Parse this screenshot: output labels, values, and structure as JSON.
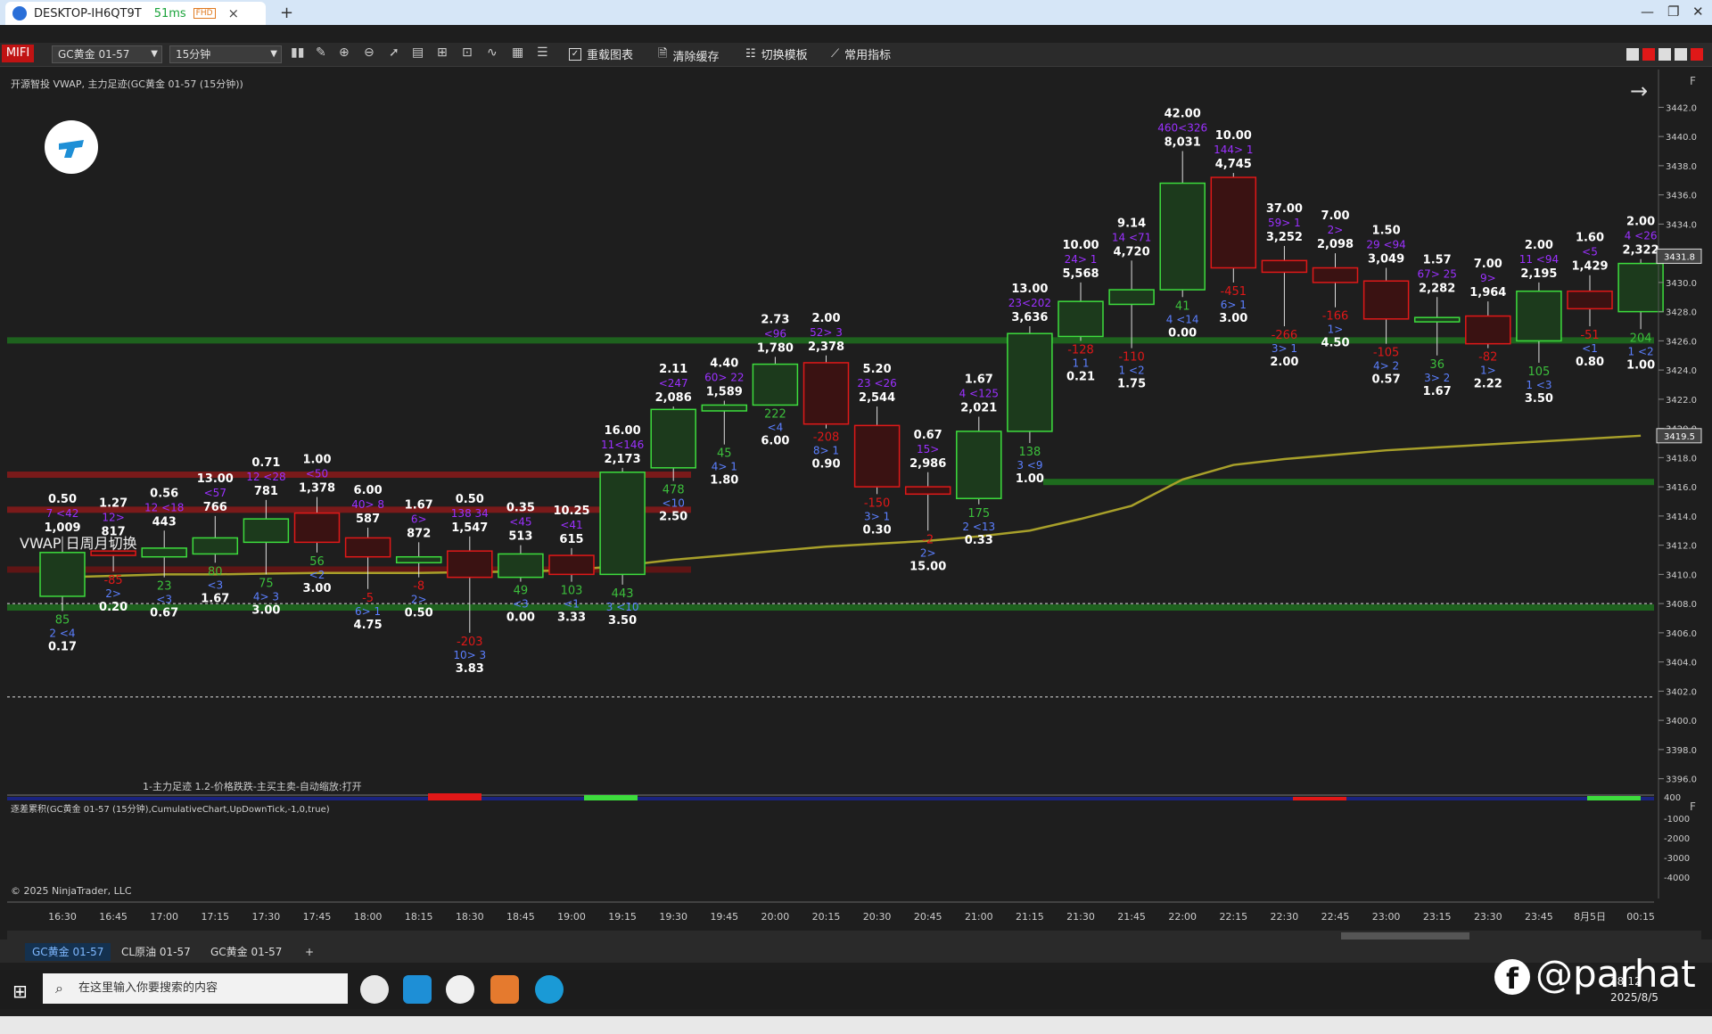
{
  "browser": {
    "tab_title": "DESKTOP-IH6QT9T",
    "latency": "51ms",
    "quality_badge": "FHD",
    "close_glyph": "×",
    "new_tab_glyph": "+",
    "win_min": "—",
    "win_max": "❐",
    "win_close": "✕"
  },
  "toolbar": {
    "logo_text": "MIFI",
    "instrument_select": "GC黄金 01-57",
    "interval_select": "15分钟",
    "reload_label": "重载图表",
    "clear_cache_label": "清除缓存",
    "switch_template_label": "切换模板",
    "common_indicators_label": "常用指标"
  },
  "chart_header": {
    "title": "开源智投 VWAP, 主力足迹(GC黄金 01-57 (15分钟))",
    "vwap_note": "VWAP 日周月切换",
    "indicator_note": "1-主力足迹 1.2-价格跌跌-主买主卖-自动缩放:打开",
    "sub_title": "逐差累积(GC黄金 01-57 (15分钟),CumulativeChart,UpDownTick,-1,0,true)",
    "copyright": "© 2025 NinjaTrader, LLC",
    "panel_flag": "F",
    "arrow_glyph": "→"
  },
  "chart_data": {
    "type": "candlestick",
    "y_axis_labels": [
      "3442.0",
      "3440.0",
      "3438.0",
      "3436.0",
      "3434.0",
      "3432.0",
      "3430.0",
      "3428.0",
      "3426.0",
      "3424.0",
      "3422.0",
      "3420.0",
      "3418.0",
      "3416.0",
      "3414.0",
      "3412.0",
      "3410.0",
      "3408.0",
      "3406.0",
      "3404.0",
      "3402.0",
      "3400.0",
      "3398.0",
      "3396.0"
    ],
    "ylim": [
      3395,
      3443
    ],
    "price_markers": [
      {
        "label": "3431.8",
        "value": 3431.8
      },
      {
        "label": "3419.5",
        "value": 3419.5
      }
    ],
    "sub_axis_labels": [
      "400",
      "-1000",
      "-2000",
      "-3000",
      "-4000"
    ],
    "x_labels": [
      "16:30",
      "16:45",
      "17:00",
      "17:15",
      "17:30",
      "17:45",
      "18:00",
      "18:15",
      "18:30",
      "18:45",
      "19:00",
      "19:15",
      "19:30",
      "19:45",
      "20:00",
      "20:15",
      "20:30",
      "20:45",
      "21:00",
      "21:15",
      "21:30",
      "21:45",
      "22:00",
      "22:15",
      "22:30",
      "22:45",
      "23:00",
      "23:15",
      "23:30",
      "23:45",
      "8月5日",
      "00:15"
    ],
    "candles": [
      {
        "o": 3408.5,
        "c": 3411.5,
        "h": 3412.6,
        "l": 3407.5,
        "up": true,
        "top": [
          "0.50",
          "7 <42",
          "1,009"
        ],
        "bot": [
          "85",
          "2 <4",
          "0.17"
        ]
      },
      {
        "o": 3411.6,
        "c": 3411.3,
        "h": 3412.3,
        "l": 3410.2,
        "up": false,
        "top": [
          "1.27",
          "12>",
          "817"
        ],
        "bot": [
          "-85",
          "2>",
          "0.20"
        ]
      },
      {
        "o": 3411.2,
        "c": 3411.8,
        "h": 3413.0,
        "l": 3409.8,
        "up": true,
        "top": [
          "0.56",
          "12 <18",
          "443"
        ],
        "bot": [
          "23",
          "<3",
          "0.67"
        ]
      },
      {
        "o": 3411.4,
        "c": 3412.5,
        "h": 3414.0,
        "l": 3410.8,
        "up": true,
        "top": [
          "13.00",
          "<57",
          "766"
        ],
        "bot": [
          "80",
          "<3",
          "1.67"
        ]
      },
      {
        "o": 3412.2,
        "c": 3413.8,
        "h": 3415.1,
        "l": 3410.0,
        "up": true,
        "top": [
          "0.71",
          "12 <28",
          "781"
        ],
        "bot": [
          "75",
          "4> 3",
          "3.00"
        ]
      },
      {
        "o": 3414.2,
        "c": 3412.2,
        "h": 3415.3,
        "l": 3411.5,
        "up": false,
        "top": [
          "1.00",
          "<50",
          "1,378"
        ],
        "bot": [
          "56",
          "<2",
          "3.00"
        ]
      },
      {
        "o": 3412.5,
        "c": 3411.2,
        "h": 3413.2,
        "l": 3409.0,
        "up": false,
        "top": [
          "6.00",
          "40> 8",
          "587"
        ],
        "bot": [
          "-5",
          "6> 1",
          "4.75"
        ]
      },
      {
        "o": 3410.8,
        "c": 3411.2,
        "h": 3412.2,
        "l": 3409.8,
        "up": true,
        "top": [
          "1.67",
          "6>",
          "872"
        ],
        "bot": [
          "-8",
          "2>",
          "0.50"
        ]
      },
      {
        "o": 3411.6,
        "c": 3409.8,
        "h": 3412.6,
        "l": 3406.0,
        "up": false,
        "top": [
          "0.50",
          "138 34",
          "1,547"
        ],
        "bot": [
          "-203",
          "10> 3",
          "3.83"
        ]
      },
      {
        "o": 3409.8,
        "c": 3411.4,
        "h": 3412.0,
        "l": 3409.5,
        "up": true,
        "top": [
          "0.35",
          "<45",
          "513"
        ],
        "bot": [
          "49",
          "<3",
          "0.00"
        ]
      },
      {
        "o": 3411.3,
        "c": 3410.0,
        "h": 3411.8,
        "l": 3409.5,
        "up": false,
        "top": [
          "10.25",
          "<41",
          "615"
        ],
        "bot": [
          "103",
          "<1",
          "3.33"
        ]
      },
      {
        "o": 3410.0,
        "c": 3417.0,
        "h": 3417.3,
        "l": 3409.3,
        "up": true,
        "top": [
          "16.00",
          "11<146",
          "2,173"
        ],
        "bot": [
          "443",
          "3 <10",
          "3.50"
        ]
      },
      {
        "o": 3417.3,
        "c": 3421.3,
        "h": 3421.5,
        "l": 3416.4,
        "up": true,
        "top": [
          "2.11",
          "<247",
          "2,086"
        ],
        "bot": [
          "478",
          "<10",
          "2.50"
        ]
      },
      {
        "o": 3421.2,
        "c": 3421.6,
        "h": 3421.9,
        "l": 3418.9,
        "up": true,
        "top": [
          "4.40",
          "60> 22",
          "1,589"
        ],
        "bot": [
          "45",
          "4> 1",
          "1.80"
        ]
      },
      {
        "o": 3421.6,
        "c": 3424.4,
        "h": 3424.9,
        "l": 3421.6,
        "up": true,
        "top": [
          "2.73",
          "<96",
          "1,780"
        ],
        "bot": [
          "222",
          "<4",
          "6.00"
        ]
      },
      {
        "o": 3424.5,
        "c": 3420.3,
        "h": 3425.0,
        "l": 3420.0,
        "up": false,
        "top": [
          "2.00",
          "52> 3",
          "2,378"
        ],
        "bot": [
          "-208",
          "8> 1",
          "0.90"
        ]
      },
      {
        "o": 3420.2,
        "c": 3416.0,
        "h": 3421.5,
        "l": 3415.5,
        "up": false,
        "top": [
          "5.20",
          "23 <26",
          "2,544"
        ],
        "bot": [
          "-150",
          "3> 1",
          "0.30"
        ]
      },
      {
        "o": 3416.0,
        "c": 3415.5,
        "h": 3417.0,
        "l": 3413.0,
        "up": false,
        "top": [
          "0.67",
          "15>",
          "2,986"
        ],
        "bot": [
          "-2",
          "2>",
          "15.00"
        ]
      },
      {
        "o": 3415.2,
        "c": 3419.8,
        "h": 3420.8,
        "l": 3414.8,
        "up": true,
        "top": [
          "1.67",
          "4 <125",
          "2,021"
        ],
        "bot": [
          "175",
          "2 <13",
          "0.33"
        ]
      },
      {
        "o": 3419.8,
        "c": 3426.5,
        "h": 3427.0,
        "l": 3419.0,
        "up": true,
        "top": [
          "13.00",
          "23<202",
          "3,636"
        ],
        "bot": [
          "138",
          "3 <9",
          "1.00"
        ]
      },
      {
        "o": 3426.3,
        "c": 3428.7,
        "h": 3430.0,
        "l": 3426.0,
        "up": true,
        "top": [
          "10.00",
          "24> 1",
          "5,568"
        ],
        "bot": [
          "-128",
          "1 1",
          "0.21"
        ]
      },
      {
        "o": 3428.5,
        "c": 3429.5,
        "h": 3431.5,
        "l": 3425.5,
        "up": true,
        "top": [
          "9.14",
          "14 <71",
          "4,720"
        ],
        "bot": [
          "-110",
          "1 <2",
          "1.75"
        ]
      },
      {
        "o": 3429.5,
        "c": 3436.8,
        "h": 3439.0,
        "l": 3429.0,
        "up": true,
        "top": [
          "42.00",
          "460<326",
          "8,031"
        ],
        "bot": [
          "41",
          "4 <14",
          "0.00"
        ]
      },
      {
        "o": 3437.2,
        "c": 3431.0,
        "h": 3437.5,
        "l": 3430.0,
        "up": false,
        "top": [
          "10.00",
          "144> 1",
          "4,745"
        ],
        "bot": [
          "-451",
          "6> 1",
          "3.00"
        ]
      },
      {
        "o": 3431.5,
        "c": 3430.7,
        "h": 3432.5,
        "l": 3427.0,
        "up": false,
        "top": [
          "37.00",
          "59> 1",
          "3,252"
        ],
        "bot": [
          "-266",
          "3> 1",
          "2.00"
        ]
      },
      {
        "o": 3431.0,
        "c": 3430.0,
        "h": 3432.0,
        "l": 3428.3,
        "up": false,
        "top": [
          "7.00",
          "2>",
          "2,098"
        ],
        "bot": [
          "-166",
          "1>",
          "4.50"
        ]
      },
      {
        "o": 3430.1,
        "c": 3427.5,
        "h": 3431.0,
        "l": 3425.8,
        "up": false,
        "top": [
          "1.50",
          "29 <94",
          "3,049"
        ],
        "bot": [
          "-105",
          "4> 2",
          "0.57"
        ]
      },
      {
        "o": 3427.3,
        "c": 3427.6,
        "h": 3429.0,
        "l": 3425.0,
        "up": true,
        "top": [
          "1.57",
          "67> 25",
          "2,282"
        ],
        "bot": [
          "36",
          "3> 2",
          "1.67"
        ]
      },
      {
        "o": 3427.7,
        "c": 3425.8,
        "h": 3428.7,
        "l": 3425.5,
        "up": false,
        "top": [
          "7.00",
          "9>",
          "1,964"
        ],
        "bot": [
          "-82",
          "1>",
          "2.22"
        ]
      },
      {
        "o": 3426.0,
        "c": 3429.4,
        "h": 3430.0,
        "l": 3424.5,
        "up": true,
        "top": [
          "2.00",
          "11 <94",
          "2,195"
        ],
        "bot": [
          "105",
          "1 <3",
          "3.50"
        ]
      },
      {
        "o": 3429.4,
        "c": 3428.2,
        "h": 3430.5,
        "l": 3427.0,
        "up": false,
        "top": [
          "1.60",
          "<5",
          "1,429"
        ],
        "bot": [
          "-51",
          "<1",
          "0.80"
        ]
      },
      {
        "o": 3428.0,
        "c": 3431.3,
        "h": 3431.6,
        "l": 3426.8,
        "up": true,
        "top": [
          "2.00",
          "4 <26",
          "2,322"
        ],
        "bot": [
          "204",
          "1 <2",
          "1.00"
        ]
      }
    ],
    "vwap": [
      3409.8,
      3409.9,
      3410.0,
      3410.0,
      3410.05,
      3410.1,
      3410.1,
      3410.1,
      3410.15,
      3410.2,
      3410.3,
      3410.6,
      3411.0,
      3411.3,
      3411.6,
      3411.9,
      3412.1,
      3412.3,
      3412.6,
      3413.0,
      3413.8,
      3414.7,
      3416.5,
      3417.5,
      3417.9,
      3418.2,
      3418.5,
      3418.7,
      3418.9,
      3419.1,
      3419.3,
      3419.5
    ],
    "volume_profile_levels": [
      {
        "price": 3416.8,
        "color": "#8b1a1a"
      },
      {
        "price": 3414.4,
        "color": "#8b1a1a"
      },
      {
        "price": 3410.3,
        "color": "#6b1414"
      },
      {
        "price": 3407.7,
        "color": "#1f6e1f"
      },
      {
        "price": 3416.3,
        "color": "#1f7a1f"
      },
      {
        "price": 3426.0,
        "color": "#1f6e1f"
      }
    ],
    "colors": {
      "up": "#3ddc3d",
      "down": "#e01818",
      "vwap": "#a8a02a",
      "bg": "#1e1e1e",
      "label_purple": "#9b30ff",
      "label_blue": "#5b7fff"
    }
  },
  "bottom_tabs": [
    "GC黄金 01-57",
    "CL原油 01-57",
    "GC黄金 01-57",
    "+"
  ],
  "taskbar": {
    "search_placeholder": "在这里输入你要搜索的内容",
    "time": "18:12",
    "date": "2025/8/5",
    "watermark": "@parhat"
  }
}
